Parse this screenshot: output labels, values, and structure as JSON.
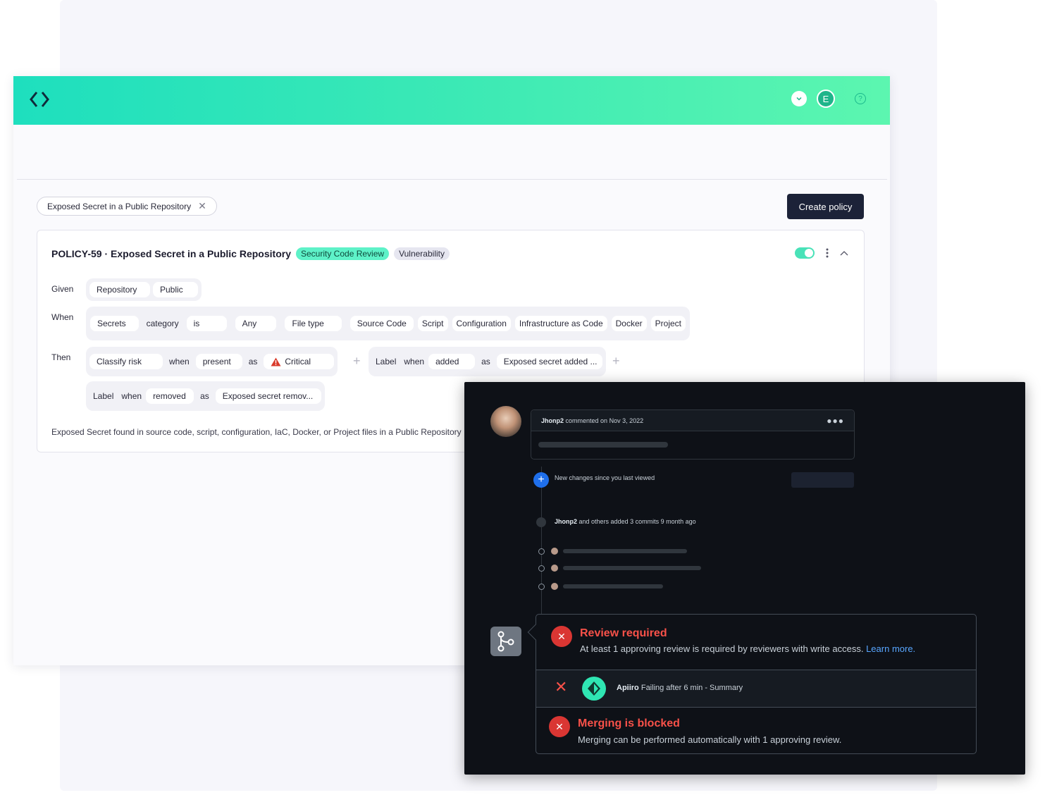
{
  "header": {
    "avatar_initial": "E",
    "help_glyph": "?",
    "icons": [
      "logo-icon",
      "chevron-down-icon",
      "help-icon"
    ]
  },
  "filter": {
    "label": "Exposed Secret in a Public Repository",
    "close": "✕"
  },
  "actions": {
    "create_policy": "Create policy"
  },
  "policy": {
    "title": "POLICY-59 · Exposed Secret in a Public Repository",
    "tags": [
      "Security Code Review",
      "Vulnerability"
    ],
    "given": {
      "label": "Given",
      "items": [
        "Repository",
        "Public"
      ]
    },
    "when": {
      "label": "When",
      "g1": [
        "Secrets",
        "category",
        "is"
      ],
      "any": "Any",
      "file_type": "File type",
      "types": [
        "Source Code",
        "Script",
        "Configuration",
        "Infrastructure as Code",
        "Docker",
        "Project"
      ]
    },
    "then": {
      "label": "Then",
      "a1": [
        "Classify risk",
        "when",
        "present",
        "as",
        "Critical"
      ],
      "a2": [
        "Label",
        "when",
        "added",
        "as",
        "Exposed secret added ..."
      ],
      "a3": [
        "Label",
        "when",
        "removed",
        "as",
        "Exposed secret remov..."
      ]
    },
    "description": "Exposed Secret found in source code, script, configuration, IaC, Docker, or Project files in a Public Repository"
  },
  "pr": {
    "comment_user": "Jhonp2",
    "comment_meta": "commented on Nov 3, 2022",
    "new_changes": "New changes since you last viewed",
    "commits_user": "Jhonp2",
    "commits_meta": "and others added 3 commits 9 month ago",
    "review_title": "Review required",
    "review_sub": "At least 1 approving review is required by reviewers with write access.",
    "learn_more": "Learn more.",
    "check_name": "Apiiro",
    "check_status": "Failing after 6 min - Summary",
    "blocked_title": "Merging is blocked",
    "blocked_sub": "Merging can be performed automatically with 1 approving review."
  },
  "colors": {
    "accent": "#2fe6b3",
    "danger": "#f85149",
    "primary_dark": "#1c2238"
  }
}
